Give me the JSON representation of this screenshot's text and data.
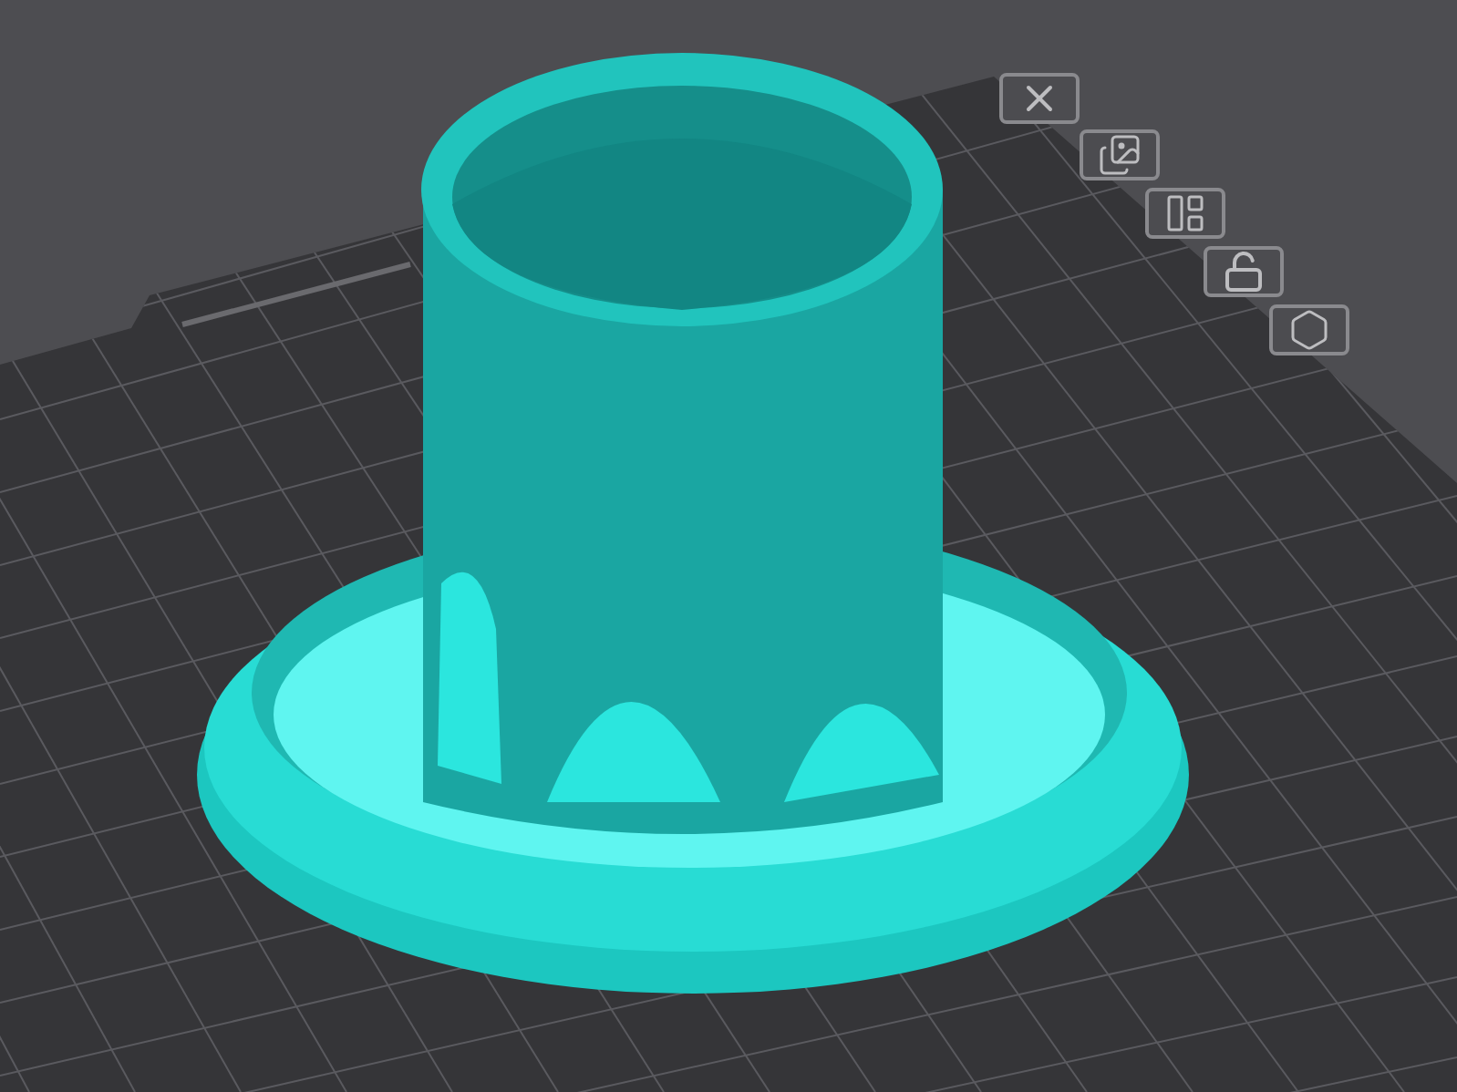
{
  "plate_toolbar": [
    {
      "kind": "delete"
    },
    {
      "kind": "arrange"
    },
    {
      "kind": "layout"
    },
    {
      "kind": "lock",
      "locked": false
    },
    {
      "kind": "settings"
    }
  ]
}
